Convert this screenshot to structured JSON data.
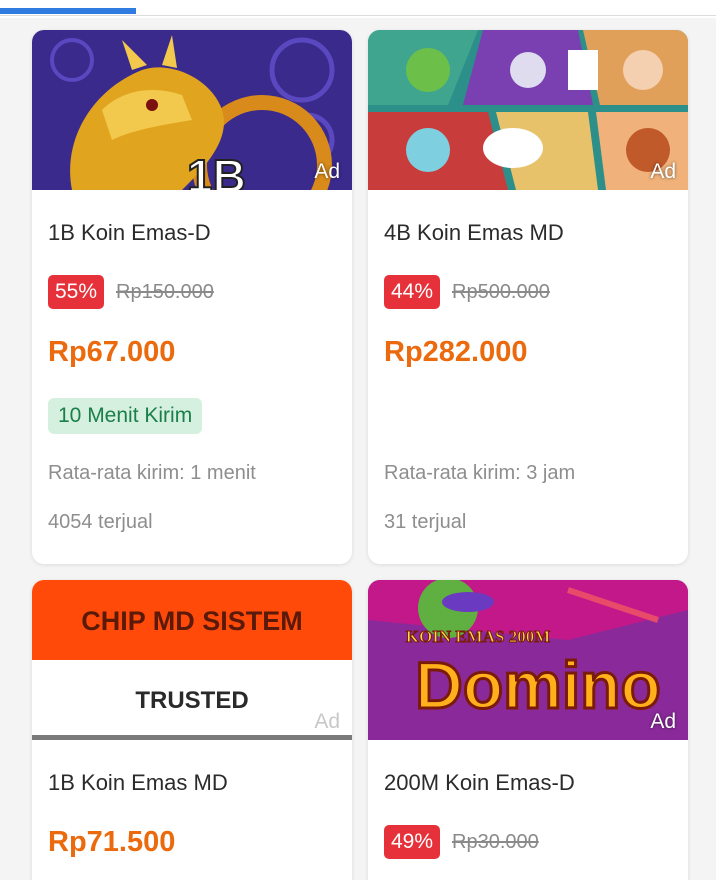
{
  "tab_progress": 0.19,
  "products": [
    {
      "title": "1B Koin Emas-D",
      "ad_label": "Ad",
      "image_text": "1B",
      "discount": "55%",
      "old_price": "Rp150.000",
      "price": "Rp67.000",
      "badge": "10 Menit Kirim",
      "delivery": "Rata-rata kirim: 1 menit",
      "sold": "4054 terjual"
    },
    {
      "title": "4B Koin Emas MD",
      "ad_label": "Ad",
      "discount": "44%",
      "old_price": "Rp500.000",
      "price": "Rp282.000",
      "delivery": "Rata-rata kirim: 3 jam",
      "sold": "31 terjual"
    },
    {
      "title": "1B Koin Emas MD",
      "ad_label": "Ad",
      "image_text_top": "CHIP MD SISTEM",
      "image_text_bottom": "TRUSTED",
      "price": "Rp71.500"
    },
    {
      "title": "200M Koin Emas-D",
      "ad_label": "Ad",
      "image_text_small": "KOIN EMAS 200M",
      "image_text_big": "Domino",
      "discount": "49%",
      "old_price": "Rp30.000"
    }
  ],
  "colors": {
    "price": "#ec6a0e",
    "discount_bg": "#e6313a",
    "badge_bg": "#d6f0df",
    "badge_text": "#1a7f4a",
    "progress": "#2f7be0"
  }
}
